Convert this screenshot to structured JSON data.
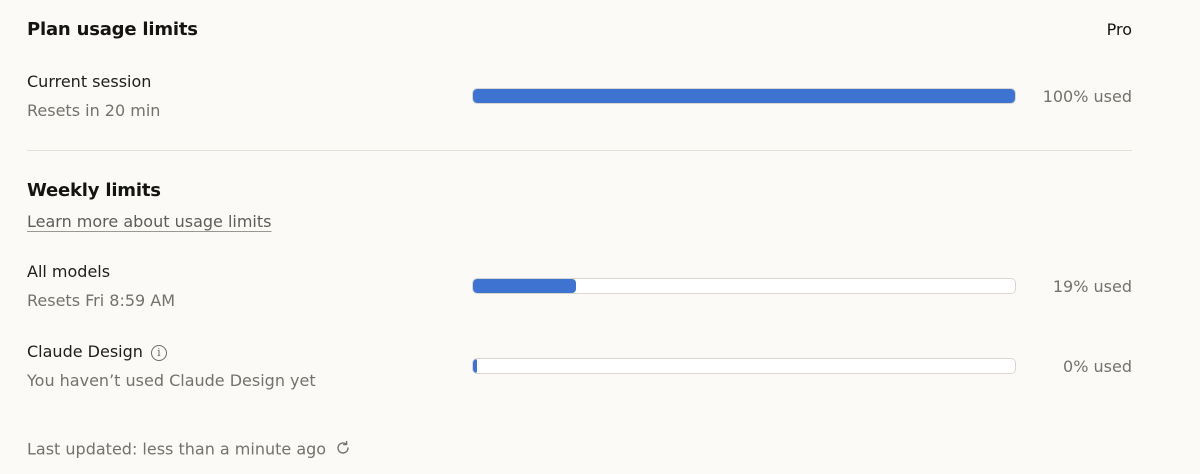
{
  "header": {
    "title": "Plan usage limits",
    "plan": "Pro"
  },
  "current_session": {
    "title": "Current session",
    "reset": "Resets in 20 min",
    "percent": 100,
    "label": "100% used"
  },
  "weekly": {
    "title": "Weekly limits",
    "learn_more": "Learn more about usage limits",
    "rows": [
      {
        "title": "All models",
        "sub": "Resets Fri 8:59 AM",
        "percent": 19,
        "label": "19% used"
      },
      {
        "title": "Claude Design",
        "sub": "You haven’t used Claude Design yet",
        "percent": 0,
        "label": "0% used",
        "icon": "info-icon"
      }
    ]
  },
  "footer": {
    "updated": "Last updated: less than a minute ago",
    "icon": "refresh-icon"
  },
  "colors": {
    "bar_fill": "#3f73d2",
    "background": "#fbfaf7"
  }
}
